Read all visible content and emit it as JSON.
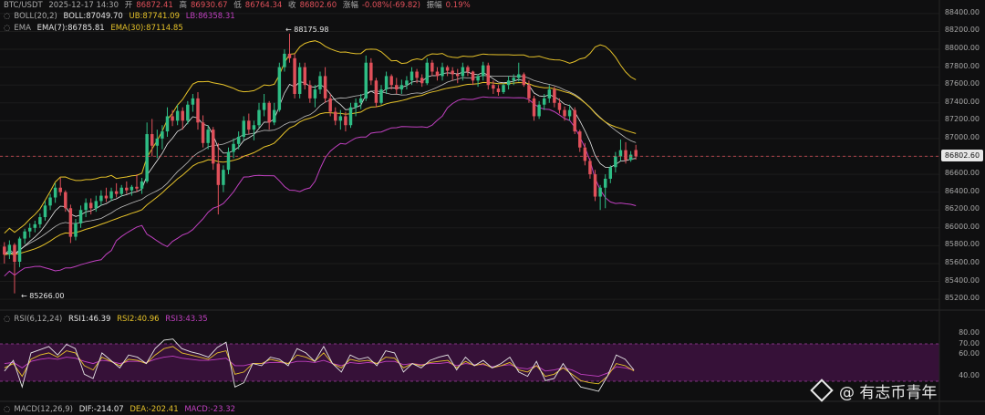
{
  "header": {
    "symbol": "BTC/USDT",
    "datetime": "2025-12-17 14:30",
    "open_label": "开",
    "open": "86872.41",
    "high_label": "高",
    "high": "86930.67",
    "low_label": "低",
    "low": "86764.34",
    "close_label": "收",
    "close": "86802.60",
    "change_label": "涨幅",
    "change": "-0.08%(-69.82)",
    "amp_label": "振幅",
    "amp": "0.19%"
  },
  "indicators": {
    "boll": {
      "name": "BOLL(20,2)",
      "mid": "BOLL:87049.70",
      "ub": "UB:87741.09",
      "lb": "LB:86358.31"
    },
    "ema": {
      "name": "EMA",
      "ema7": "EMA(7):86785.81",
      "ema30": "EMA(30):87114.85"
    },
    "rsi": {
      "name": "RSI(6,12,24)",
      "rsi1": "RSI1:46.39",
      "rsi2": "RSI2:40.96",
      "rsi3": "RSI3:43.35"
    },
    "macd": {
      "name": "MACD(12,26,9)",
      "dif": "DIF:-214.07",
      "dea": "DEA:-202.41",
      "macd": "MACD:-23.32"
    }
  },
  "annotations": {
    "high_marker": "← 88175.98",
    "low_marker": "← 85266.00"
  },
  "price_axis": [
    "88400.00",
    "88200.00",
    "88000.00",
    "87800.00",
    "87600.00",
    "87400.00",
    "87200.00",
    "87000.00",
    "86800.00",
    "86600.00",
    "86400.00",
    "86200.00",
    "86000.00",
    "85800.00",
    "85600.00",
    "85400.00",
    "85200.00"
  ],
  "current_price": "86802.60",
  "rsi_axis": [
    "80.00",
    "70.00",
    "60.00",
    "40.00"
  ],
  "watermark": "@ 有志币青年",
  "colors": {
    "up": "#2ebd85",
    "down": "#e0505a",
    "boll_band": "#e6c229",
    "boll_lower": "#c040c0",
    "ema7": "#e8e8e8",
    "ema30": "#e6c229",
    "rsi_zone": "#3d1240"
  },
  "chart_data": {
    "type": "candlestick",
    "ylim": [
      85150,
      88450
    ],
    "candles": [
      {
        "o": 85790,
        "h": 85840,
        "l": 85600,
        "c": 85700
      },
      {
        "o": 85700,
        "h": 85860,
        "l": 85650,
        "c": 85810
      },
      {
        "o": 85810,
        "h": 85830,
        "l": 85266,
        "c": 85620
      },
      {
        "o": 85620,
        "h": 85900,
        "l": 85560,
        "c": 85880
      },
      {
        "o": 85880,
        "h": 85990,
        "l": 85820,
        "c": 85960
      },
      {
        "o": 85960,
        "h": 86050,
        "l": 85890,
        "c": 86000
      },
      {
        "o": 86000,
        "h": 86080,
        "l": 85950,
        "c": 86040
      },
      {
        "o": 86040,
        "h": 86160,
        "l": 86000,
        "c": 86120
      },
      {
        "o": 86120,
        "h": 86300,
        "l": 86080,
        "c": 86250
      },
      {
        "o": 86250,
        "h": 86380,
        "l": 86200,
        "c": 86340
      },
      {
        "o": 86340,
        "h": 86500,
        "l": 86280,
        "c": 86450
      },
      {
        "o": 86450,
        "h": 86560,
        "l": 86360,
        "c": 86400
      },
      {
        "o": 86400,
        "h": 86420,
        "l": 86180,
        "c": 86220
      },
      {
        "o": 86220,
        "h": 86260,
        "l": 85830,
        "c": 85900
      },
      {
        "o": 85900,
        "h": 86100,
        "l": 85860,
        "c": 86050
      },
      {
        "o": 86050,
        "h": 86250,
        "l": 86000,
        "c": 86200
      },
      {
        "o": 86200,
        "h": 86330,
        "l": 86120,
        "c": 86280
      },
      {
        "o": 86280,
        "h": 86330,
        "l": 86150,
        "c": 86220
      },
      {
        "o": 86220,
        "h": 86360,
        "l": 86180,
        "c": 86300
      },
      {
        "o": 86300,
        "h": 86420,
        "l": 86250,
        "c": 86360
      },
      {
        "o": 86360,
        "h": 86450,
        "l": 86290,
        "c": 86330
      },
      {
        "o": 86330,
        "h": 86450,
        "l": 86300,
        "c": 86410
      },
      {
        "o": 86410,
        "h": 86500,
        "l": 86340,
        "c": 86380
      },
      {
        "o": 86380,
        "h": 86480,
        "l": 86350,
        "c": 86450
      },
      {
        "o": 86450,
        "h": 86520,
        "l": 86380,
        "c": 86420
      },
      {
        "o": 86420,
        "h": 86480,
        "l": 86360,
        "c": 86460
      },
      {
        "o": 86460,
        "h": 86600,
        "l": 86400,
        "c": 86440
      },
      {
        "o": 86440,
        "h": 86560,
        "l": 86380,
        "c": 86520
      },
      {
        "o": 86520,
        "h": 87180,
        "l": 86500,
        "c": 87050
      },
      {
        "o": 87050,
        "h": 87220,
        "l": 86800,
        "c": 86920
      },
      {
        "o": 86920,
        "h": 87100,
        "l": 86780,
        "c": 87000
      },
      {
        "o": 87000,
        "h": 87150,
        "l": 86880,
        "c": 87080
      },
      {
        "o": 87080,
        "h": 87350,
        "l": 87020,
        "c": 87250
      },
      {
        "o": 87250,
        "h": 87320,
        "l": 87140,
        "c": 87200
      },
      {
        "o": 87200,
        "h": 87380,
        "l": 87150,
        "c": 87310
      },
      {
        "o": 87310,
        "h": 87350,
        "l": 87100,
        "c": 87200
      },
      {
        "o": 87200,
        "h": 87420,
        "l": 87160,
        "c": 87380
      },
      {
        "o": 87380,
        "h": 87500,
        "l": 87300,
        "c": 87450
      },
      {
        "o": 87450,
        "h": 87520,
        "l": 87100,
        "c": 87180
      },
      {
        "o": 87180,
        "h": 87260,
        "l": 86900,
        "c": 86950
      },
      {
        "o": 86950,
        "h": 87150,
        "l": 86880,
        "c": 87100
      },
      {
        "o": 87100,
        "h": 87130,
        "l": 86650,
        "c": 86720
      },
      {
        "o": 86720,
        "h": 86950,
        "l": 86150,
        "c": 86480
      },
      {
        "o": 86480,
        "h": 86700,
        "l": 86400,
        "c": 86650
      },
      {
        "o": 86650,
        "h": 86900,
        "l": 86600,
        "c": 86850
      },
      {
        "o": 86850,
        "h": 87000,
        "l": 86780,
        "c": 86940
      },
      {
        "o": 86940,
        "h": 87080,
        "l": 86880,
        "c": 87020
      },
      {
        "o": 87020,
        "h": 87250,
        "l": 86980,
        "c": 87200
      },
      {
        "o": 87200,
        "h": 87280,
        "l": 87050,
        "c": 87100
      },
      {
        "o": 87100,
        "h": 87200,
        "l": 86980,
        "c": 87150
      },
      {
        "o": 87150,
        "h": 87400,
        "l": 87120,
        "c": 87320
      },
      {
        "o": 87320,
        "h": 87500,
        "l": 87250,
        "c": 87400
      },
      {
        "o": 87400,
        "h": 87420,
        "l": 87100,
        "c": 87180
      },
      {
        "o": 87180,
        "h": 87400,
        "l": 87150,
        "c": 87320
      },
      {
        "o": 87320,
        "h": 87850,
        "l": 87300,
        "c": 87800
      },
      {
        "o": 87800,
        "h": 88000,
        "l": 87750,
        "c": 87950
      },
      {
        "o": 87950,
        "h": 88176,
        "l": 87850,
        "c": 87900
      },
      {
        "o": 87900,
        "h": 87950,
        "l": 87450,
        "c": 87500
      },
      {
        "o": 87500,
        "h": 87850,
        "l": 87450,
        "c": 87800
      },
      {
        "o": 87800,
        "h": 87850,
        "l": 87550,
        "c": 87600
      },
      {
        "o": 87600,
        "h": 87650,
        "l": 87400,
        "c": 87450
      },
      {
        "o": 87450,
        "h": 87600,
        "l": 87350,
        "c": 87550
      },
      {
        "o": 87550,
        "h": 87750,
        "l": 87500,
        "c": 87700
      },
      {
        "o": 87700,
        "h": 87800,
        "l": 87400,
        "c": 87450
      },
      {
        "o": 87450,
        "h": 87500,
        "l": 87250,
        "c": 87300
      },
      {
        "o": 87300,
        "h": 87350,
        "l": 87150,
        "c": 87200
      },
      {
        "o": 87200,
        "h": 87320,
        "l": 87100,
        "c": 87250
      },
      {
        "o": 87250,
        "h": 87300,
        "l": 87080,
        "c": 87150
      },
      {
        "o": 87150,
        "h": 87400,
        "l": 87120,
        "c": 87350
      },
      {
        "o": 87350,
        "h": 87450,
        "l": 87250,
        "c": 87400
      },
      {
        "o": 87400,
        "h": 87500,
        "l": 87330,
        "c": 87450
      },
      {
        "o": 87450,
        "h": 87930,
        "l": 87420,
        "c": 87850
      },
      {
        "o": 87850,
        "h": 87900,
        "l": 87600,
        "c": 87650
      },
      {
        "o": 87650,
        "h": 87680,
        "l": 87350,
        "c": 87400
      },
      {
        "o": 87400,
        "h": 87600,
        "l": 87380,
        "c": 87550
      },
      {
        "o": 87550,
        "h": 87750,
        "l": 87500,
        "c": 87700
      },
      {
        "o": 87700,
        "h": 87720,
        "l": 87550,
        "c": 87600
      },
      {
        "o": 87600,
        "h": 87680,
        "l": 87500,
        "c": 87550
      },
      {
        "o": 87550,
        "h": 87660,
        "l": 87500,
        "c": 87600
      },
      {
        "o": 87600,
        "h": 87700,
        "l": 87550,
        "c": 87650
      },
      {
        "o": 87650,
        "h": 87800,
        "l": 87600,
        "c": 87750
      },
      {
        "o": 87750,
        "h": 87780,
        "l": 87620,
        "c": 87680
      },
      {
        "o": 87680,
        "h": 87720,
        "l": 87580,
        "c": 87620
      },
      {
        "o": 87620,
        "h": 87900,
        "l": 87600,
        "c": 87850
      },
      {
        "o": 87850,
        "h": 87880,
        "l": 87700,
        "c": 87750
      },
      {
        "o": 87750,
        "h": 87800,
        "l": 87650,
        "c": 87700
      },
      {
        "o": 87700,
        "h": 87850,
        "l": 87650,
        "c": 87800
      },
      {
        "o": 87800,
        "h": 87820,
        "l": 87700,
        "c": 87760
      },
      {
        "o": 87760,
        "h": 87800,
        "l": 87650,
        "c": 87720
      },
      {
        "o": 87720,
        "h": 87780,
        "l": 87620,
        "c": 87700
      },
      {
        "o": 87700,
        "h": 87850,
        "l": 87650,
        "c": 87800
      },
      {
        "o": 87800,
        "h": 87820,
        "l": 87700,
        "c": 87750
      },
      {
        "o": 87750,
        "h": 87760,
        "l": 87600,
        "c": 87650
      },
      {
        "o": 87650,
        "h": 87720,
        "l": 87580,
        "c": 87700
      },
      {
        "o": 87700,
        "h": 87860,
        "l": 87650,
        "c": 87820
      },
      {
        "o": 87820,
        "h": 87850,
        "l": 87550,
        "c": 87600
      },
      {
        "o": 87600,
        "h": 87650,
        "l": 87500,
        "c": 87560
      },
      {
        "o": 87560,
        "h": 87600,
        "l": 87480,
        "c": 87520
      },
      {
        "o": 87520,
        "h": 87620,
        "l": 87500,
        "c": 87600
      },
      {
        "o": 87600,
        "h": 87700,
        "l": 87550,
        "c": 87650
      },
      {
        "o": 87650,
        "h": 87720,
        "l": 87600,
        "c": 87680
      },
      {
        "o": 87680,
        "h": 87850,
        "l": 87640,
        "c": 87720
      },
      {
        "o": 87720,
        "h": 87740,
        "l": 87580,
        "c": 87600
      },
      {
        "o": 87600,
        "h": 87650,
        "l": 87400,
        "c": 87450
      },
      {
        "o": 87450,
        "h": 87480,
        "l": 87200,
        "c": 87250
      },
      {
        "o": 87250,
        "h": 87420,
        "l": 87220,
        "c": 87380
      },
      {
        "o": 87380,
        "h": 87500,
        "l": 87320,
        "c": 87450
      },
      {
        "o": 87450,
        "h": 87600,
        "l": 87400,
        "c": 87550
      },
      {
        "o": 87550,
        "h": 87580,
        "l": 87350,
        "c": 87400
      },
      {
        "o": 87400,
        "h": 87450,
        "l": 87280,
        "c": 87320
      },
      {
        "o": 87320,
        "h": 87360,
        "l": 87200,
        "c": 87250
      },
      {
        "o": 87250,
        "h": 87380,
        "l": 87200,
        "c": 87320
      },
      {
        "o": 87320,
        "h": 87350,
        "l": 87050,
        "c": 87080
      },
      {
        "o": 87080,
        "h": 87100,
        "l": 86850,
        "c": 86900
      },
      {
        "o": 86900,
        "h": 86950,
        "l": 86700,
        "c": 86750
      },
      {
        "o": 86750,
        "h": 86780,
        "l": 86550,
        "c": 86600
      },
      {
        "o": 86600,
        "h": 86650,
        "l": 86300,
        "c": 86350
      },
      {
        "o": 86350,
        "h": 86480,
        "l": 86200,
        "c": 86450
      },
      {
        "o": 86450,
        "h": 86600,
        "l": 86220,
        "c": 86550
      },
      {
        "o": 86550,
        "h": 86700,
        "l": 86500,
        "c": 86680
      },
      {
        "o": 86680,
        "h": 86850,
        "l": 86620,
        "c": 86800
      },
      {
        "o": 86800,
        "h": 86990,
        "l": 86750,
        "c": 86870
      },
      {
        "o": 86870,
        "h": 86960,
        "l": 86720,
        "c": 86760
      },
      {
        "o": 86760,
        "h": 86860,
        "l": 86740,
        "c": 86820
      },
      {
        "o": 86872,
        "h": 86930,
        "l": 86764,
        "c": 86802
      }
    ],
    "rsi": {
      "ylim": [
        20,
        85
      ],
      "zone": [
        30,
        70
      ],
      "rsi1": [
        45,
        55,
        30,
        62,
        65,
        68,
        60,
        70,
        66,
        42,
        38,
        62,
        55,
        48,
        60,
        58,
        52,
        66,
        74,
        75,
        66,
        63,
        61,
        58,
        67,
        72,
        30,
        34,
        52,
        50,
        58,
        56,
        50,
        66,
        62,
        54,
        68,
        52,
        44,
        60,
        56,
        58,
        50,
        64,
        62,
        44,
        52,
        48,
        55,
        58,
        60,
        46,
        58,
        50,
        55,
        48,
        52,
        58,
        44,
        40,
        54,
        36,
        38,
        52,
        40,
        30,
        28,
        26,
        40,
        60,
        56,
        46
      ],
      "rsi2": [
        48,
        52,
        40,
        56,
        60,
        62,
        58,
        64,
        62,
        50,
        46,
        58,
        54,
        50,
        56,
        55,
        52,
        60,
        66,
        68,
        62,
        60,
        58,
        56,
        62,
        64,
        42,
        44,
        52,
        52,
        56,
        54,
        52,
        60,
        58,
        54,
        62,
        52,
        48,
        56,
        54,
        55,
        52,
        58,
        57,
        48,
        52,
        50,
        53,
        54,
        55,
        48,
        54,
        50,
        52,
        48,
        50,
        53,
        46,
        44,
        50,
        40,
        42,
        48,
        42,
        36,
        34,
        33,
        40,
        52,
        50,
        45
      ],
      "rsi3": [
        52,
        53,
        48,
        54,
        56,
        57,
        56,
        58,
        57,
        54,
        52,
        55,
        54,
        52,
        54,
        54,
        53,
        56,
        58,
        59,
        57,
        56,
        55,
        55,
        56,
        57,
        50,
        50,
        52,
        52,
        53,
        53,
        52,
        54,
        54,
        53,
        55,
        52,
        50,
        53,
        52,
        53,
        52,
        54,
        54,
        51,
        52,
        51,
        52,
        52,
        53,
        50,
        52,
        51,
        51,
        49,
        50,
        51,
        48,
        47,
        50,
        45,
        46,
        48,
        46,
        42,
        41,
        40,
        43,
        49,
        48,
        46
      ]
    },
    "boll": {
      "mid": "87049.70",
      "ub": "87741.09",
      "lb": "86358.31"
    },
    "ema": {
      "ema7": "86785.81",
      "ema30": "87114.85"
    },
    "high_point": 88175.98,
    "low_point": 85266.0,
    "current": 86802.6
  }
}
